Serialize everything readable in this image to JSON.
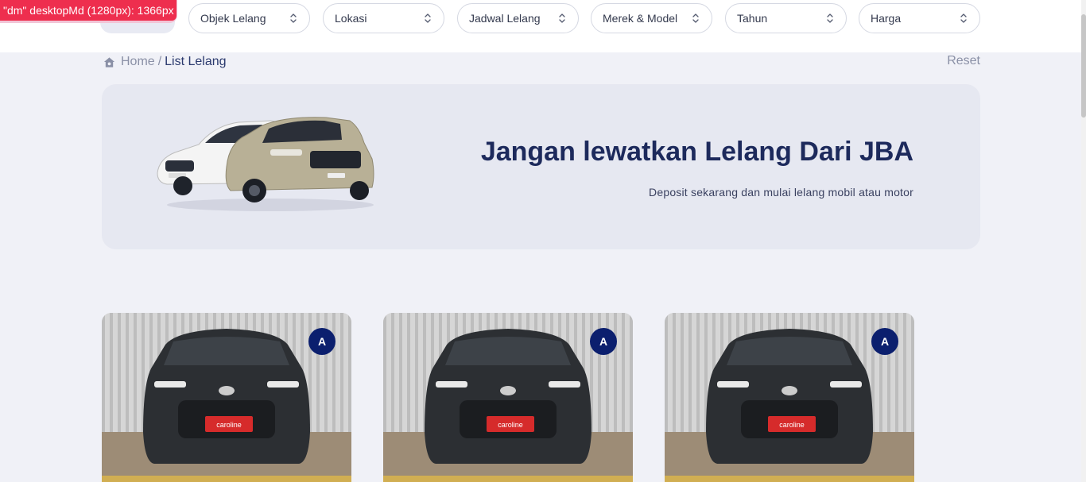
{
  "debug": {
    "label": "\"dm\" desktopMd (1280px): 1366px"
  },
  "filters": [
    {
      "label": "Objek Lelang",
      "icon": "chevron-up-down-icon"
    },
    {
      "label": "Lokasi",
      "icon": "chevron-up-down-icon"
    },
    {
      "label": "Jadwal Lelang",
      "icon": "chevron-up-down-icon"
    },
    {
      "label": "Merek & Model",
      "icon": "chevron-up-down-icon"
    },
    {
      "label": "Tahun",
      "icon": "chevron-up-down-icon"
    },
    {
      "label": "Harga",
      "icon": "chevron-up-down-icon"
    }
  ],
  "breadcrumb": {
    "home": "Home",
    "separator": "/",
    "current": "List Lelang",
    "icon": "home-icon"
  },
  "reset_label": "Reset",
  "banner": {
    "title": "Jangan lewatkan Lelang Dari JBA",
    "subtitle": "Deposit sekarang dan mulai lelang mobil atau motor"
  },
  "cards": [
    {
      "grade": "A",
      "plate": "caroline"
    },
    {
      "grade": "A",
      "plate": "caroline"
    },
    {
      "grade": "A",
      "plate": "caroline"
    }
  ],
  "colors": {
    "accent": "#0b1f6e",
    "title": "#1d2a5c",
    "debug": "#ee2e4e"
  }
}
